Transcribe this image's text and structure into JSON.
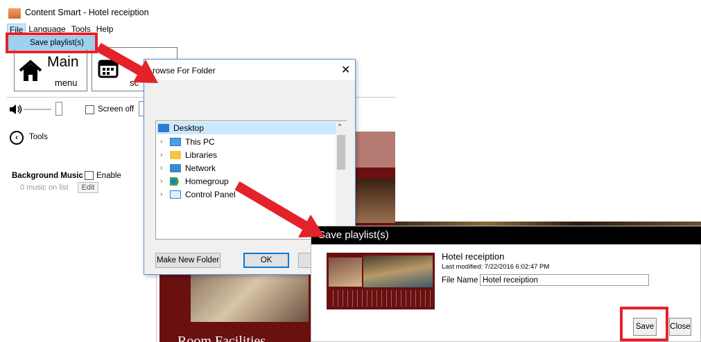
{
  "window": {
    "title": "Content Smart - Hotel receiption"
  },
  "menubar": {
    "items": [
      "File",
      "Language",
      "Tools",
      "Help"
    ]
  },
  "file_menu": {
    "items": [
      "Save playlist(s)"
    ]
  },
  "tiles": {
    "main_line1": "Main",
    "main_line2": "menu",
    "schedule_partial": "sc"
  },
  "toolbar": {
    "screen_off_label": "Screen off"
  },
  "sidebar": {
    "tools_label": "Tools",
    "bg_music_label": "Background Music",
    "enable_label": "Enable",
    "music_count_text": "0  music on list",
    "edit_button": "Edit"
  },
  "browse_dialog": {
    "title": "rowse For Folder",
    "close_glyph": "✕",
    "tree": [
      {
        "label": "Desktop",
        "selected": true,
        "icon": "desktop-icon"
      },
      {
        "label": "This PC",
        "icon": "computer-icon"
      },
      {
        "label": "Libraries",
        "icon": "library-icon"
      },
      {
        "label": "Network",
        "icon": "network-icon"
      },
      {
        "label": "Homegroup",
        "icon": "homegroup-icon"
      },
      {
        "label": "Control Panel",
        "icon": "control-panel-icon"
      }
    ],
    "make_new_folder_button": "Make New Folder",
    "ok_button": "OK"
  },
  "background_preview": {
    "heading_partial": "Room Facilities"
  },
  "save_dialog": {
    "title": "Save playlist(s)",
    "playlist_name": "Hotel receiption",
    "last_modified": "Last modified: 7/22/2016 6:02:47 PM",
    "file_name_label": "File Name",
    "file_name_value": "Hotel receiption",
    "save_button": "Save",
    "close_button": "Close"
  },
  "colors": {
    "highlight_red": "#e3222a",
    "arrow_red": "#e3222a",
    "menu_highlight": "#9fd0f0",
    "dialog_header": "#000000",
    "hotel_bg": "#6a1010"
  }
}
